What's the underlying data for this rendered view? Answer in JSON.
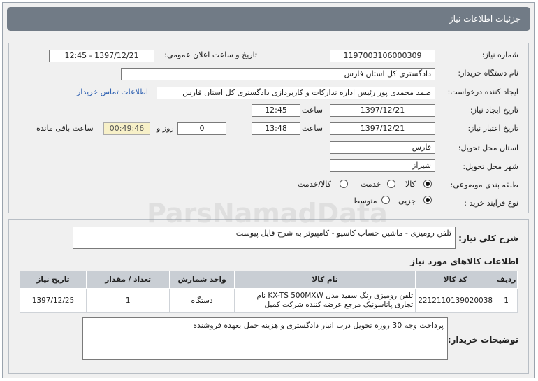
{
  "header": {
    "title": "جزئیات اطلاعات نیاز"
  },
  "form": {
    "need_number_label": "شماره نیاز:",
    "need_number": "1197003106000309",
    "announce_label": "تاریخ و ساعت اعلان عمومی:",
    "announce_value": "1397/12/21 - 12:45",
    "buyer_org_label": "نام دستگاه خریدار:",
    "buyer_org": "دادگستری کل استان فارس",
    "creator_label": "ایجاد کننده درخواست:",
    "creator": "صمد محمدی پور رئیس اداره تدارکات و کاربردازی دادگستری کل استان فارس",
    "contact_link": "اطلاعات تماس خریدار",
    "created_date_label": "تاریخ ایجاد نیاز:",
    "created_date": "1397/12/21",
    "time_label": "ساعت",
    "created_time": "12:45",
    "validity_label": "تاریخ اعتبار نیاز:",
    "validity_date": "1397/12/21",
    "validity_time": "13:48",
    "days_value": "0",
    "days_label": "روز و",
    "remaining_time": "00:49:46",
    "remaining_label": "ساعت باقی مانده",
    "province_label": "استان محل تحویل:",
    "province": "فارس",
    "city_label": "شهر محل تحویل:",
    "city": "شیراز",
    "category_label": "طبقه بندی موضوعی:",
    "category_options": [
      "کالا",
      "خدمت",
      "کالا/خدمت"
    ],
    "category_selected": "کالا",
    "process_label": "نوع فرآیند خرید :",
    "process_options": [
      "جزیی",
      "متوسط"
    ],
    "process_selected": "جزیی"
  },
  "general": {
    "label": "شرح کلی نیاز:",
    "value": "تلفن رومیزی - ماشین حساب کاسیو - کامپیوتر به شرح فایل پیوست"
  },
  "items_section": {
    "title": "اطلاعات کالاهای مورد نیاز",
    "columns": [
      "ردیف",
      "کد کالا",
      "نام کالا",
      "واحد شمارش",
      "تعداد / مقدار",
      "تاریخ نیاز"
    ],
    "rows": [
      {
        "row": "1",
        "code": "2212110139020038",
        "name": "تلفن رومیزی رنگ سفید مدل KX-TS 500MXW نام تجاری پاناسونیک مرجع عرضه کننده شرکت کمیل",
        "unit": "دستگاه",
        "qty": "1",
        "date": "1397/12/25"
      }
    ]
  },
  "buyer_notes": {
    "label": "توضیحات خریدار:",
    "value": "پرداخت وجه 30 روزه تحویل درب انبار دادگستری و هزینه حمل بعهده فروشنده"
  },
  "watermark": {
    "text": "ParsNamadData"
  }
}
